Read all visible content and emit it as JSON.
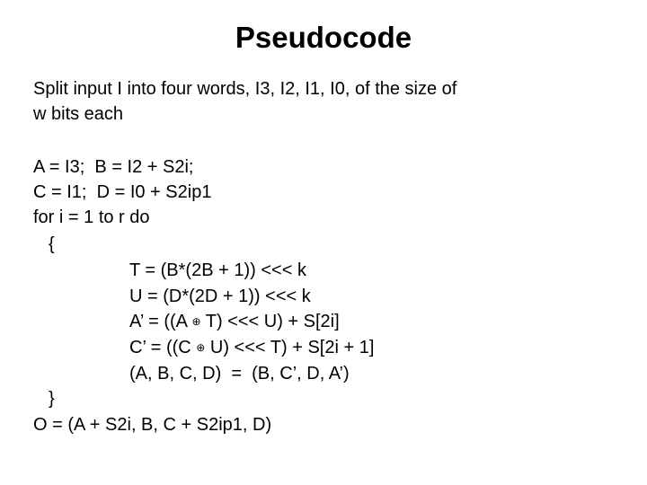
{
  "slide": {
    "title": "Pseudocode",
    "intro_line1": "Split input I into four words, I3, I2, I1, I0, of the size of",
    "intro_line2": "w bits each",
    "code": {
      "init1": "A = I3;  B = I2 + S2i;",
      "init2": "C = I1;  D = I0 + S2ip1",
      "loop_header": "for i = 1 to r do",
      "open_brace": "{",
      "t_line": "T = (B*(2B + 1)) <<< k",
      "u_line": "U = (D*(2D + 1)) <<< k",
      "a_prime": {
        "pre": "A’ = ((A ",
        "op": "⊕",
        "post": " T) <<< U) + S[2i]"
      },
      "c_prime": {
        "pre": "C’ = ((C ",
        "op": "⊕",
        "post": " U) <<< T) + S[2i + 1]"
      },
      "rotate": "(A, B, C, D)  =  (B, C’, D, A’)",
      "close_brace": "}",
      "output": "O = (A + S2i, B, C + S2ip1, D)"
    }
  }
}
